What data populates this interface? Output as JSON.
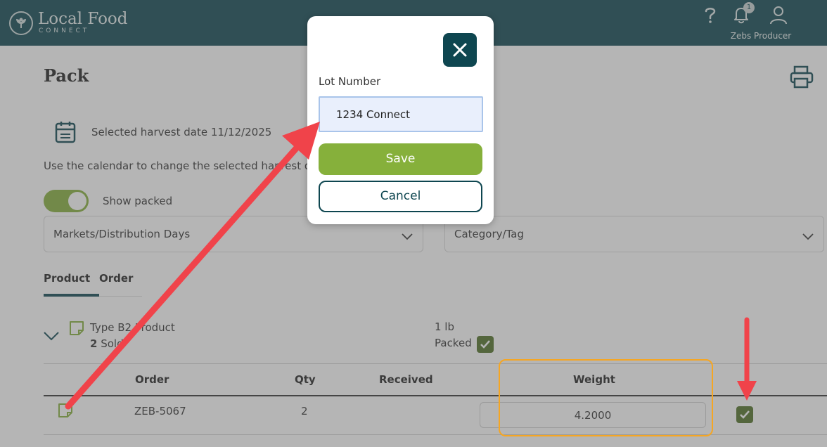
{
  "header": {
    "brand_name": "Local Food",
    "brand_sub": "CONNECT",
    "notification_count": "1",
    "user_name": "Zebs Producer"
  },
  "page": {
    "title": "Pack",
    "harvest_label": "Selected harvest date 11/12/2025",
    "harvest_help": "Use the calendar to change the selected harvest date",
    "show_packed_label": "Show packed",
    "show_packed_on": true
  },
  "filters": {
    "markets_label": "Markets/Distribution Days",
    "category_label": "Category/Tag"
  },
  "tabs": [
    {
      "label": "Product",
      "active": true
    },
    {
      "label": "Order",
      "active": false
    }
  ],
  "product": {
    "name": "Type B2 Product",
    "sold_count": "2",
    "sold_text": "Sold",
    "unit": "1 lb",
    "packed_label": "Packed",
    "packed_checked": true
  },
  "table": {
    "headers": {
      "order": "Order",
      "qty": "Qty",
      "received": "Received",
      "weight": "Weight"
    },
    "rows": [
      {
        "order": "ZEB-5067",
        "qty": "2",
        "received": "",
        "weight": "4.2000",
        "checked": true
      }
    ]
  },
  "modal": {
    "lot_label": "Lot Number",
    "lot_value": "1234 Connect",
    "save_label": "Save",
    "cancel_label": "Cancel"
  },
  "colors": {
    "brand_dark": "#0e4650",
    "accent_green": "#86b03b",
    "check_green": "#4f7025",
    "annotation_red": "#f0434a",
    "highlight_orange": "#f5a623"
  },
  "icons": [
    "logo-icon",
    "help-icon",
    "bell-icon",
    "user-icon",
    "printer-icon",
    "calendar-icon",
    "chevron-down-icon",
    "note-icon",
    "check-icon",
    "close-icon"
  ]
}
